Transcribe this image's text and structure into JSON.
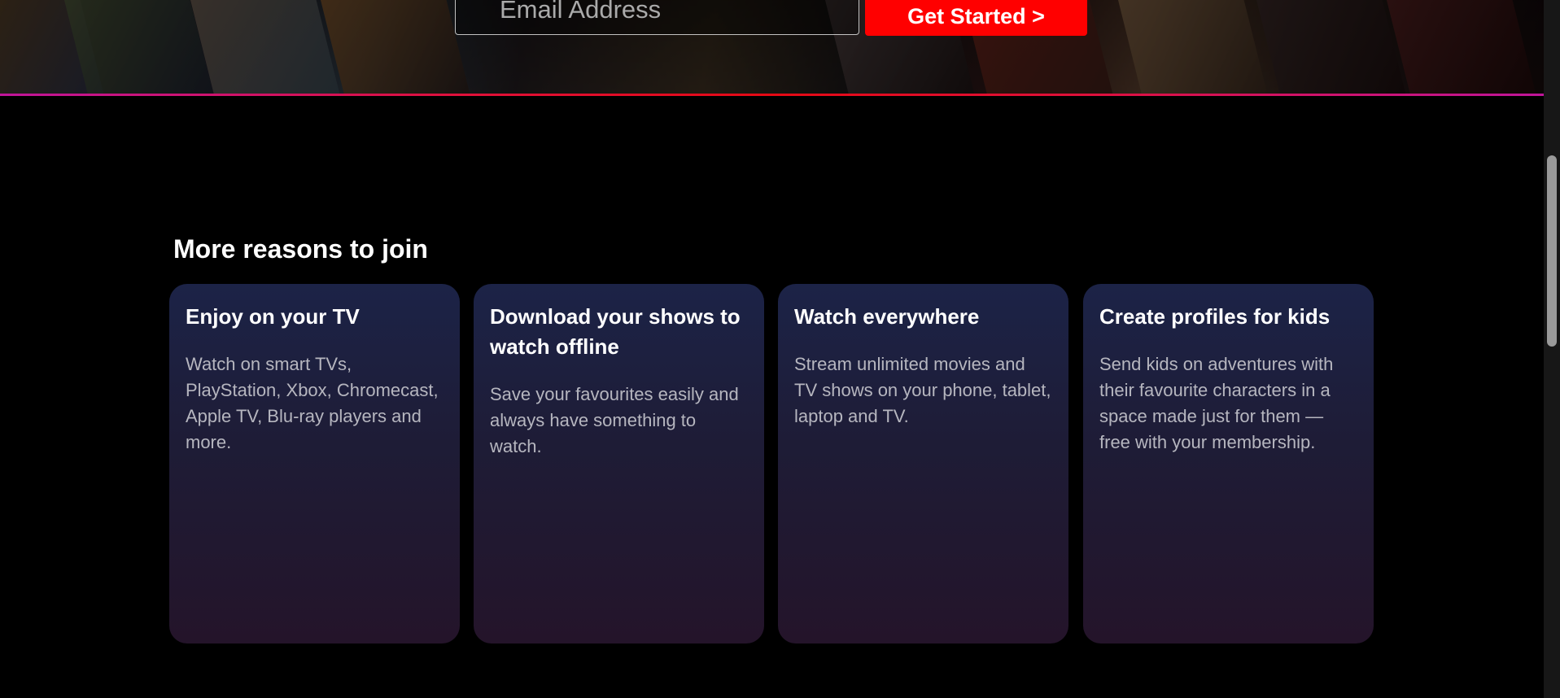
{
  "hero": {
    "email_placeholder": "Email Address",
    "cta_label": "Get Started >",
    "accent_color": "#ff0000"
  },
  "reasons": {
    "title": "More reasons to join",
    "cards": [
      {
        "title": "Enjoy on your TV",
        "description": "Watch on smart TVs, PlayStation, Xbox, Chromecast, Apple TV, Blu-ray players and more."
      },
      {
        "title": "Download your shows to watch offline",
        "description": "Save your favourites easily and always have something to watch."
      },
      {
        "title": "Watch everywhere",
        "description": "Stream unlimited movies and TV shows on your phone, tablet, laptop and TV."
      },
      {
        "title": "Create profiles for kids",
        "description": "Send kids on adventures with their favourite characters in a space made just for them — free with your membership."
      }
    ]
  }
}
